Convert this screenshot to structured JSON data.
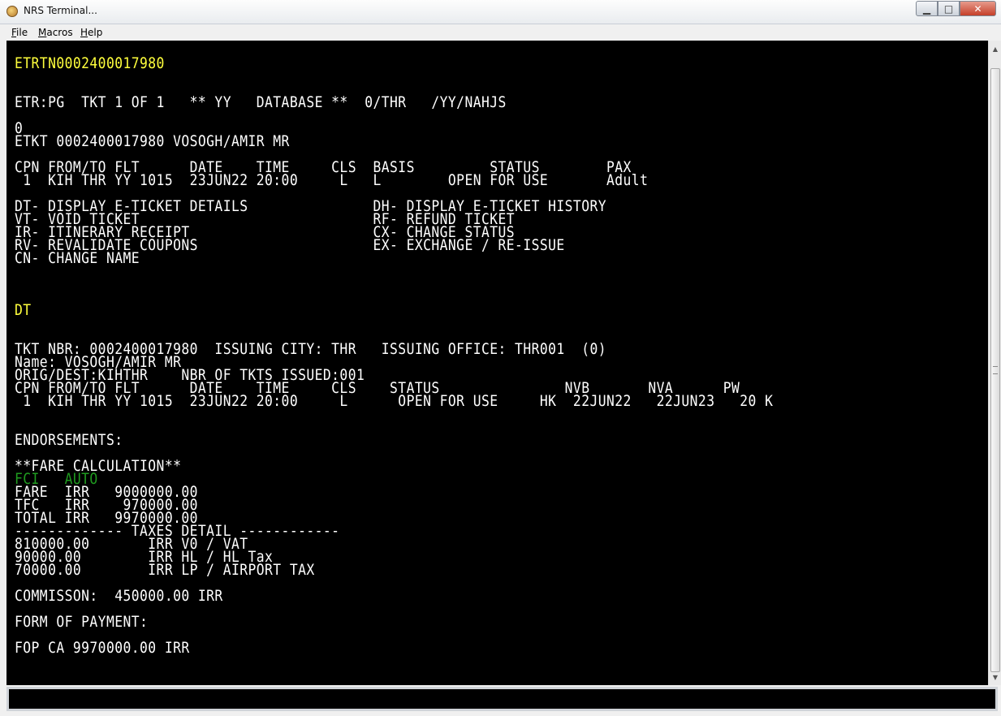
{
  "window": {
    "title": "NRS Terminal...",
    "icon": "app-icon",
    "buttons": {
      "minimize": "▁",
      "maximize": "□",
      "close": "✕"
    }
  },
  "menu": [
    {
      "key": "F",
      "rest": "ile"
    },
    {
      "key": "M",
      "rest": "acros"
    },
    {
      "key": "H",
      "rest": "elp"
    }
  ],
  "terminal": {
    "lines": [
      "ETRTN0002400017980",
      "ETR:PG  TKT 1 OF 1   ** YY   DATABASE **  0/THR   /YY/NAHJS",
      "0",
      "ETKT 0002400017980 VOSOGH/AMIR MR",
      "CPN FROM/TO FLT      DATE    TIME     CLS  BASIS         STATUS        PAX",
      " 1  KIH THR YY 1015  23JUN22 20:00     L   L        OPEN FOR USE       Adult",
      "DT- DISPLAY E-TICKET DETAILS               DH- DISPLAY E-TICKET HISTORY",
      "VT- VOID TICKET                            RF- REFUND TICKET",
      "IR- ITINERARY RECEIPT                      CX- CHANGE STATUS",
      "RV- REVALIDATE COUPONS                     EX- EXCHANGE / RE-ISSUE",
      "CN- CHANGE NAME",
      "DT",
      "TKT NBR: 0002400017980  ISSUING CITY: THR   ISSUING OFFICE: THR001  (0)",
      "Name: VOSOGH/AMIR MR",
      "ORIG/DEST:KIHTHR    NBR OF TKTS ISSUED:001",
      "CPN FROM/TO FLT      DATE    TIME     CLS    STATUS               NVB       NVA      PW",
      " 1  KIH THR YY 1015  23JUN22 20:00     L      OPEN FOR USE     HK  22JUN22   22JUN23   20 K",
      "ENDORSEMENTS:",
      "**FARE CALCULATION**",
      "FCI   AUTO",
      "FARE  IRR   9000000.00",
      "TFC   IRR    970000.00",
      "TOTAL IRR   9970000.00",
      "------------- TAXES DETAIL ------------",
      "810000.00       IRR V0 / VAT",
      "90000.00        IRR HL / HL Tax",
      "70000.00        IRR LP / AIRPORT TAX",
      "COMMISSON:  450000.00 IRR",
      "FORM OF PAYMENT:",
      "FOP CA 9970000.00 IRR"
    ]
  },
  "command_input": {
    "value": ""
  },
  "colors": {
    "terminal_bg": "#000000",
    "text": "#ffffff",
    "highlight": "#ffff3c",
    "fci": "#1f9b1f"
  }
}
